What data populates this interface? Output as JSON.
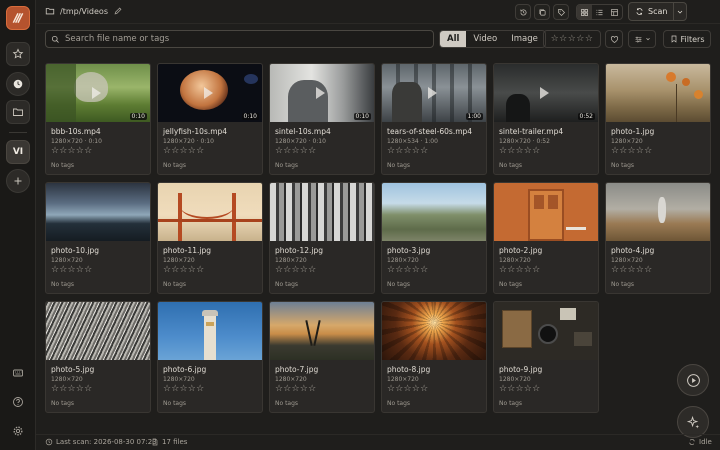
{
  "header": {
    "path": "/tmp/Videos",
    "scan_label": "Scan"
  },
  "sidebar": {
    "vault_label": "VI"
  },
  "toolbar": {
    "search_placeholder": "Search file name or tags",
    "type_filters": [
      "All",
      "Video",
      "Image"
    ],
    "type_selected": "All",
    "rating_stars": "☆☆☆☆☆",
    "filters_label": "Filters"
  },
  "files": [
    {
      "name": "bbb-10s.mp4",
      "meta": "1280×720 · 0:10",
      "duration": "0:10",
      "kind": "video",
      "stars": "☆☆☆☆☆",
      "tags": "No tags"
    },
    {
      "name": "jellyfish-10s.mp4",
      "meta": "1280×720 · 0:10",
      "duration": "0:10",
      "kind": "video",
      "stars": "☆☆☆☆☆",
      "tags": "No tags"
    },
    {
      "name": "sintel-10s.mp4",
      "meta": "1280×720 · 0:10",
      "duration": "0:10",
      "kind": "video",
      "stars": "☆☆☆☆☆",
      "tags": "No tags"
    },
    {
      "name": "tears-of-steel-60s.mp4",
      "meta": "1280×534 · 1:00",
      "duration": "1:00",
      "kind": "video",
      "stars": "☆☆☆☆☆",
      "tags": "No tags"
    },
    {
      "name": "sintel-trailer.mp4",
      "meta": "1280×720 · 0:52",
      "duration": "0:52",
      "kind": "video",
      "stars": "☆☆☆☆☆",
      "tags": "No tags"
    },
    {
      "name": "photo-1.jpg",
      "meta": "1280×720",
      "kind": "image",
      "stars": "☆☆☆☆☆",
      "tags": "No tags"
    },
    {
      "name": "photo-10.jpg",
      "meta": "1280×720",
      "kind": "image",
      "stars": "☆☆☆☆☆",
      "tags": "No tags"
    },
    {
      "name": "photo-11.jpg",
      "meta": "1280×720",
      "kind": "image",
      "stars": "☆☆☆☆☆",
      "tags": "No tags"
    },
    {
      "name": "photo-12.jpg",
      "meta": "1280×720",
      "kind": "image",
      "stars": "☆☆☆☆☆",
      "tags": "No tags"
    },
    {
      "name": "photo-3.jpg",
      "meta": "1280×720",
      "kind": "image",
      "stars": "☆☆☆☆☆",
      "tags": "No tags"
    },
    {
      "name": "photo-2.jpg",
      "meta": "1280×720",
      "kind": "image",
      "stars": "☆☆☆☆☆",
      "tags": "No tags"
    },
    {
      "name": "photo-4.jpg",
      "meta": "1280×720",
      "kind": "image",
      "stars": "☆☆☆☆☆",
      "tags": "No tags"
    },
    {
      "name": "photo-5.jpg",
      "meta": "1280×720",
      "kind": "image",
      "stars": "☆☆☆☆☆",
      "tags": "No tags"
    },
    {
      "name": "photo-6.jpg",
      "meta": "1280×720",
      "kind": "image",
      "stars": "☆☆☆☆☆",
      "tags": "No tags"
    },
    {
      "name": "photo-7.jpg",
      "meta": "1280×720",
      "kind": "image",
      "stars": "☆☆☆☆☆",
      "tags": "No tags"
    },
    {
      "name": "photo-8.jpg",
      "meta": "1280×720",
      "kind": "image",
      "stars": "☆☆☆☆☆",
      "tags": "No tags"
    },
    {
      "name": "photo-9.jpg",
      "meta": "1280×720",
      "kind": "image",
      "stars": "☆☆☆☆☆",
      "tags": "No tags"
    }
  ],
  "status": {
    "last_scan": "Last scan: 2026-08-30 07:23",
    "file_count": "17 files",
    "state": "Idle"
  }
}
